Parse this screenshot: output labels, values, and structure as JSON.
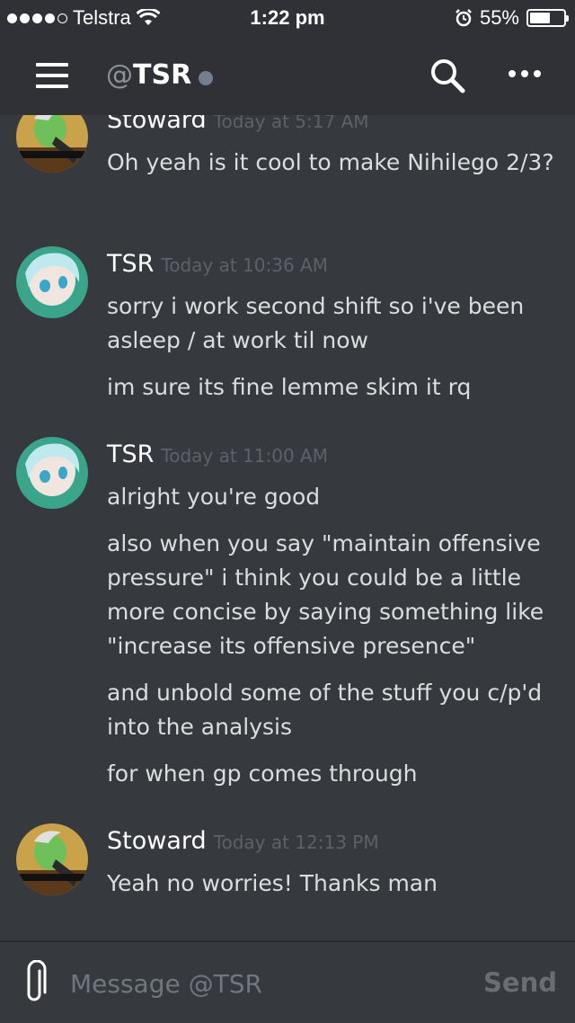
{
  "status_bar": {
    "carrier": "Telstra",
    "time": "1:22 pm",
    "battery": "55%"
  },
  "header": {
    "at": "@",
    "channel_name": "TSR"
  },
  "messages": [
    {
      "author": "Stoward",
      "timestamp": "Today at 5:17 AM",
      "lines": [
        "Oh yeah is it cool to make Nihilego 2/3?"
      ]
    },
    {
      "author": "TSR",
      "timestamp": "Today at 10:36 AM",
      "lines": [
        "sorry i work second shift so i've been asleep / at work til now",
        "im sure its fine lemme skim it rq"
      ]
    },
    {
      "author": "TSR",
      "timestamp": "Today at 11:00 AM",
      "lines": [
        "alright you're good",
        "also when you say \"maintain offensive pressure\" i think you could be a little more concise by saying something like \"increase its offensive presence\"",
        "and unbold some of the stuff you c/p'd into the analysis",
        "for when gp comes through"
      ]
    },
    {
      "author": "Stoward",
      "timestamp": "Today at 12:13 PM",
      "lines": [
        "Yeah no worries! Thanks man"
      ]
    }
  ],
  "composer": {
    "placeholder": "Message @TSR",
    "send_label": "Send"
  }
}
